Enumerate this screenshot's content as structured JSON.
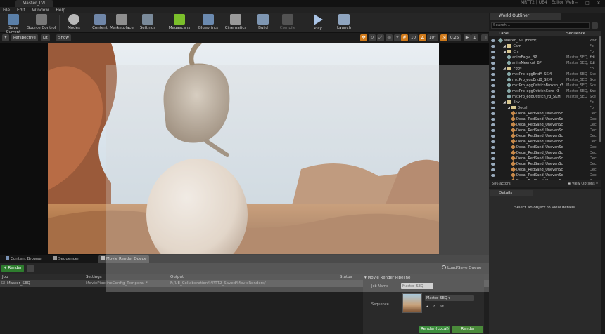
{
  "window": {
    "title": "Master_LVL",
    "project": "MRTT2 | UE4 | Editor Web"
  },
  "menu": [
    "File",
    "Edit",
    "Window",
    "Help"
  ],
  "toolbar": [
    {
      "label": "Save Current",
      "icon": "save-icon"
    },
    {
      "label": "Source Control",
      "icon": "source-control-icon"
    },
    {
      "label": "Modes",
      "icon": "modes-icon"
    },
    {
      "label": "Content",
      "icon": "content-icon"
    },
    {
      "label": "Marketplace",
      "icon": "marketplace-icon"
    },
    {
      "label": "Settings",
      "icon": "settings-icon"
    },
    {
      "label": "Megascans",
      "icon": "megascans-icon"
    },
    {
      "label": "Blueprints",
      "icon": "blueprints-icon"
    },
    {
      "label": "Cinematics",
      "icon": "cinematics-icon"
    },
    {
      "label": "Build",
      "icon": "build-icon"
    },
    {
      "label": "Compile",
      "icon": "compile-icon"
    },
    {
      "label": "Play",
      "icon": "play-icon"
    },
    {
      "label": "Launch",
      "icon": "launch-icon"
    }
  ],
  "viewport": {
    "perspective": "Perspective",
    "lit": "Lit",
    "show": "Show",
    "grid_snap": "10",
    "angle_snap": "10°",
    "scale_snap": "0.25",
    "camera_speed": "1"
  },
  "bottom_tabs": [
    "Content Browser",
    "Sequencer",
    "Movie Render Queue"
  ],
  "mrq": {
    "render_button": "Render",
    "load_save": "Load/Save Queue",
    "columns": [
      "Job",
      "Settings",
      "Output",
      "Status"
    ],
    "job": {
      "name": "Master_SEQ",
      "settings": "MoviePipelineConfig_Temporal *",
      "output": "F:/UE_Collaboration/MRTT2_Saved/MovieRenders/"
    },
    "pipeline": {
      "title": "Movie Render Pipeline",
      "job_name_label": "Job Name",
      "job_name_value": "Master_SEQ",
      "sequence_label": "Sequence",
      "sequence_value": "Master_SEQ",
      "render_local": "Render (Local)",
      "render_remote": "Render (Remote)"
    }
  },
  "outliner": {
    "tab": "World Outliner",
    "search_placeholder": "Search...",
    "col_label": "Label",
    "col_sequence": "Sequence",
    "rows": [
      {
        "label": "Master_LVL (Editor)",
        "seq": "",
        "type": "Wor",
        "indent": 0,
        "kind": "world"
      },
      {
        "label": "Cam",
        "seq": "",
        "type": "Fol",
        "indent": 1,
        "kind": "folder"
      },
      {
        "label": "Chr",
        "seq": "",
        "type": "Fol",
        "indent": 1,
        "kind": "folder"
      },
      {
        "label": "animEagle_BP",
        "seq": "Master_SEQ, sh",
        "type": "Edi",
        "indent": 2,
        "kind": "actor"
      },
      {
        "label": "animMeerkat_BP",
        "seq": "Master_SEQ, sh",
        "type": "Edi",
        "indent": 2,
        "kind": "actor"
      },
      {
        "label": "Eggs",
        "seq": "",
        "type": "Fol",
        "indent": 1,
        "kind": "folder"
      },
      {
        "label": "mktPrp_eggEndA_SKM",
        "seq": "Master_SEQ",
        "type": "Ske",
        "indent": 2,
        "kind": "actor"
      },
      {
        "label": "mktPrp_eggEndB_SKM",
        "seq": "Master_SEQ",
        "type": "Ske",
        "indent": 2,
        "kind": "actor"
      },
      {
        "label": "mktPrp_eggOstrichBroken_r3",
        "seq": "Master_SEQ",
        "type": "Ske",
        "indent": 2,
        "kind": "actor"
      },
      {
        "label": "mktPrp_eggOstrichCore_r3",
        "seq": "Master_SEQ, sh",
        "type": "Ske",
        "indent": 2,
        "kind": "actor"
      },
      {
        "label": "mktPrp_eggOstrich_r3_SKM",
        "seq": "Master_SEQ",
        "type": "Ske",
        "indent": 2,
        "kind": "actor"
      },
      {
        "label": "Env",
        "seq": "",
        "type": "Fol",
        "indent": 1,
        "kind": "folder"
      },
      {
        "label": "Decal",
        "seq": "",
        "type": "Fol",
        "indent": 2,
        "kind": "folder"
      },
      {
        "label": "Decal_RedSand_UnevenSc",
        "seq": "",
        "type": "Dec",
        "indent": 3,
        "kind": "decal"
      },
      {
        "label": "Decal_RedSand_UnevenSc",
        "seq": "",
        "type": "Dec",
        "indent": 3,
        "kind": "decal"
      },
      {
        "label": "Decal_RedSand_UnevenSc",
        "seq": "",
        "type": "Dec",
        "indent": 3,
        "kind": "decal"
      },
      {
        "label": "Decal_RedSand_UnevenSc",
        "seq": "",
        "type": "Dec",
        "indent": 3,
        "kind": "decal"
      },
      {
        "label": "Decal_RedSand_UnevenSc",
        "seq": "",
        "type": "Dec",
        "indent": 3,
        "kind": "decal"
      },
      {
        "label": "Decal_RedSand_UnevenSc",
        "seq": "",
        "type": "Dec",
        "indent": 3,
        "kind": "decal"
      },
      {
        "label": "Decal_RedSand_UnevenSc",
        "seq": "",
        "type": "Dec",
        "indent": 3,
        "kind": "decal"
      },
      {
        "label": "Decal_RedSand_UnevenSc",
        "seq": "",
        "type": "Dec",
        "indent": 3,
        "kind": "decal"
      },
      {
        "label": "Decal_RedSand_UnevenSc",
        "seq": "",
        "type": "Dec",
        "indent": 3,
        "kind": "decal"
      },
      {
        "label": "Decal_RedSand_UnevenSc",
        "seq": "",
        "type": "Dec",
        "indent": 3,
        "kind": "decal"
      },
      {
        "label": "Decal_RedSand_UnevenSc",
        "seq": "",
        "type": "Dec",
        "indent": 3,
        "kind": "decal"
      },
      {
        "label": "Decal_RedSand_UnevenSc",
        "seq": "",
        "type": "Dec",
        "indent": 3,
        "kind": "decal"
      },
      {
        "label": "Decal_RedSand_UnevenSc",
        "seq": "",
        "type": "Dec",
        "indent": 3,
        "kind": "decal"
      }
    ],
    "actor_count": "586 actors",
    "view_options": "View Options"
  },
  "details": {
    "tab": "Details",
    "message": "Select an object to view details."
  },
  "colors": {
    "accent_green": "#2e7d2e",
    "snap_orange": "#d07a1a",
    "panel_bg": "#262626"
  }
}
